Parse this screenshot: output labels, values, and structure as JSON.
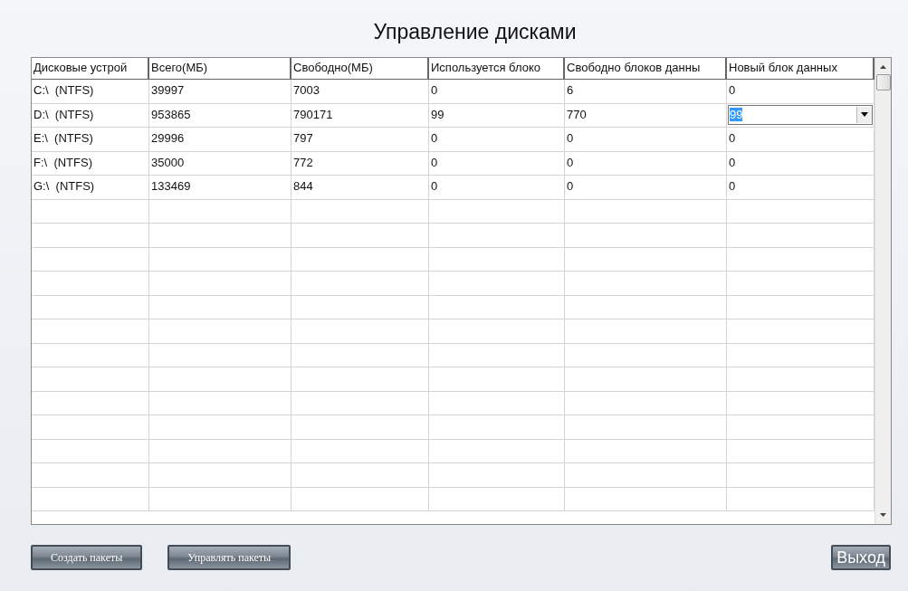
{
  "title": "Управление дисками",
  "table": {
    "columns": [
      "Дисковые устрой",
      "Всего(МБ)",
      "Свободно(МБ)",
      "Используется блоко",
      "Свободно блоков данны",
      "Новый блок данных"
    ],
    "rows": [
      {
        "cells": [
          "C:\\  (NTFS)",
          "39997",
          "7003",
          "0",
          "6",
          "0"
        ],
        "editing": false
      },
      {
        "cells": [
          "D:\\  (NTFS)",
          "953865",
          "790171",
          "99",
          "770",
          "99"
        ],
        "editing": true
      },
      {
        "cells": [
          "E:\\  (NTFS)",
          "29996",
          "797",
          "0",
          "0",
          "0"
        ],
        "editing": false
      },
      {
        "cells": [
          "F:\\  (NTFS)",
          "35000",
          "772",
          "0",
          "0",
          "0"
        ],
        "editing": false
      },
      {
        "cells": [
          "G:\\  (NTFS)",
          "133469",
          "844",
          "0",
          "0",
          "0"
        ],
        "editing": false
      }
    ]
  },
  "buttons": [
    "Создать пакеты",
    "Управлять пакеты"
  ],
  "exit_button": "Выход"
}
